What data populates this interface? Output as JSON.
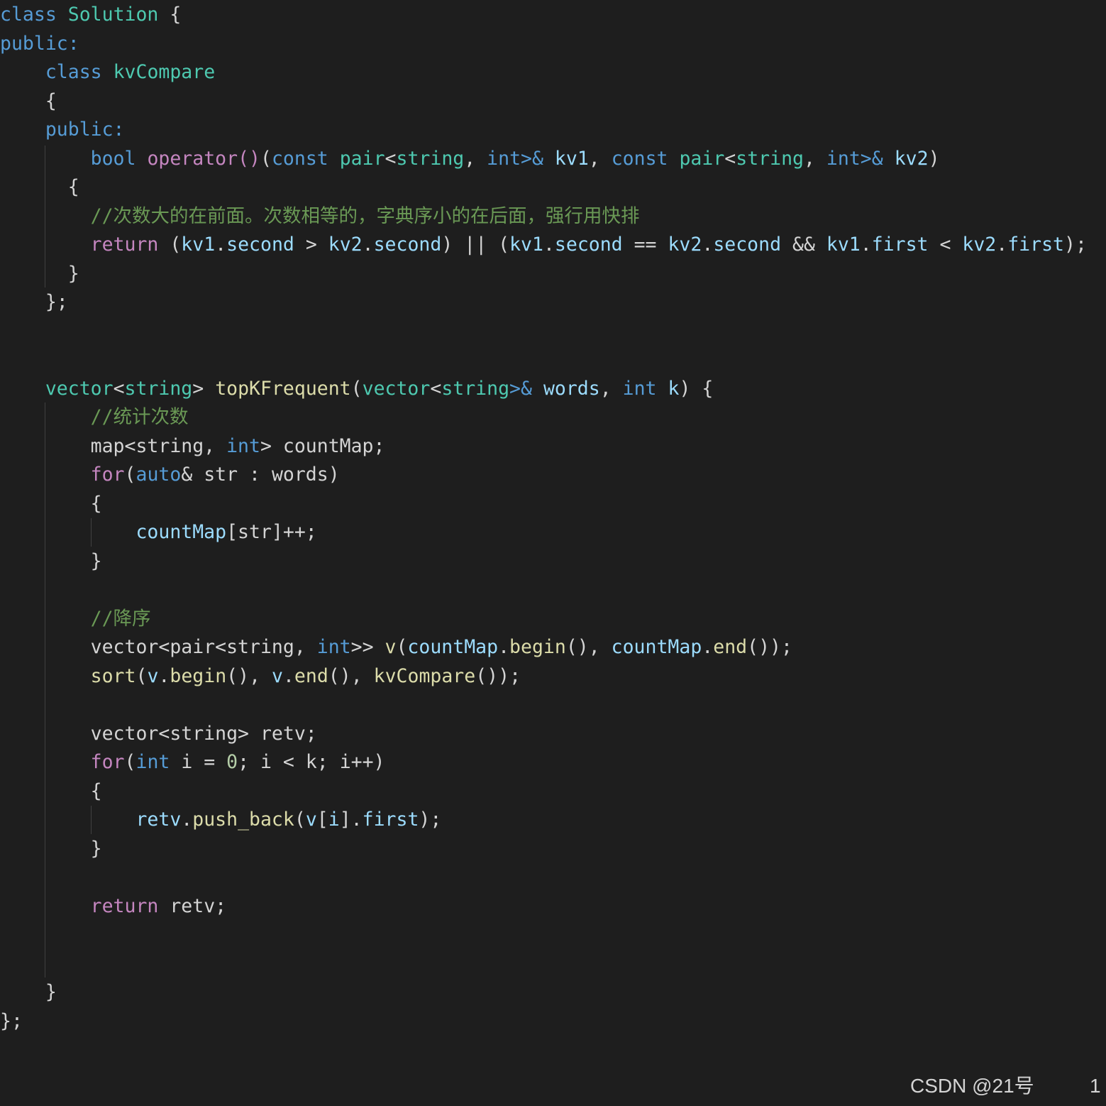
{
  "editor": {
    "lines": [
      [
        {
          "t": "class",
          "c": "kw"
        },
        {
          "t": " ",
          "c": "op"
        },
        {
          "t": "Solution",
          "c": "type"
        },
        {
          "t": " {",
          "c": "op"
        }
      ],
      [
        {
          "t": "public:",
          "c": "kw"
        }
      ],
      [
        {
          "t": "    ",
          "c": "op"
        },
        {
          "t": "class",
          "c": "kw"
        },
        {
          "t": " ",
          "c": "op"
        },
        {
          "t": "kvCompare",
          "c": "type"
        }
      ],
      [
        {
          "t": "    {",
          "c": "op"
        }
      ],
      [
        {
          "t": "    ",
          "c": "op"
        },
        {
          "t": "public:",
          "c": "kw"
        }
      ],
      [
        {
          "t": "        ",
          "c": "op"
        },
        {
          "t": "bool",
          "c": "kw"
        },
        {
          "t": " ",
          "c": "op"
        },
        {
          "t": "operator()",
          "c": "ctrl"
        },
        {
          "t": "(",
          "c": "op"
        },
        {
          "t": "const",
          "c": "kw"
        },
        {
          "t": " ",
          "c": "op"
        },
        {
          "t": "pair",
          "c": "type"
        },
        {
          "t": "<",
          "c": "op"
        },
        {
          "t": "string",
          "c": "type"
        },
        {
          "t": ", ",
          "c": "op"
        },
        {
          "t": "int",
          "c": "kw"
        },
        {
          "t": ">&",
          "c": "kw"
        },
        {
          "t": " ",
          "c": "op"
        },
        {
          "t": "kv1",
          "c": "var"
        },
        {
          "t": ", ",
          "c": "op"
        },
        {
          "t": "const",
          "c": "kw"
        },
        {
          "t": " ",
          "c": "op"
        },
        {
          "t": "pair",
          "c": "type"
        },
        {
          "t": "<",
          "c": "op"
        },
        {
          "t": "string",
          "c": "type"
        },
        {
          "t": ", ",
          "c": "op"
        },
        {
          "t": "int",
          "c": "kw"
        },
        {
          "t": ">&",
          "c": "kw"
        },
        {
          "t": " ",
          "c": "op"
        },
        {
          "t": "kv2",
          "c": "var"
        },
        {
          "t": ")",
          "c": "op"
        }
      ],
      [
        {
          "t": "      {",
          "c": "op"
        }
      ],
      [
        {
          "t": "        ",
          "c": "op"
        },
        {
          "t": "//次数大的在前面。次数相等的，字典序小的在后面，强行用快排",
          "c": "comment"
        }
      ],
      [
        {
          "t": "        ",
          "c": "op"
        },
        {
          "t": "return",
          "c": "ctrl"
        },
        {
          "t": " (",
          "c": "op"
        },
        {
          "t": "kv1",
          "c": "var"
        },
        {
          "t": ".",
          "c": "op"
        },
        {
          "t": "second",
          "c": "var"
        },
        {
          "t": " > ",
          "c": "op"
        },
        {
          "t": "kv2",
          "c": "var"
        },
        {
          "t": ".",
          "c": "op"
        },
        {
          "t": "second",
          "c": "var"
        },
        {
          "t": ") || (",
          "c": "op"
        },
        {
          "t": "kv1",
          "c": "var"
        },
        {
          "t": ".",
          "c": "op"
        },
        {
          "t": "second",
          "c": "var"
        },
        {
          "t": " == ",
          "c": "op"
        },
        {
          "t": "kv2",
          "c": "var"
        },
        {
          "t": ".",
          "c": "op"
        },
        {
          "t": "second",
          "c": "var"
        },
        {
          "t": " && ",
          "c": "op"
        },
        {
          "t": "kv1",
          "c": "var"
        },
        {
          "t": ".",
          "c": "op"
        },
        {
          "t": "first",
          "c": "var"
        },
        {
          "t": " < ",
          "c": "op"
        },
        {
          "t": "kv2",
          "c": "var"
        },
        {
          "t": ".",
          "c": "op"
        },
        {
          "t": "first",
          "c": "var"
        },
        {
          "t": ");",
          "c": "op"
        }
      ],
      [
        {
          "t": "      }",
          "c": "op"
        }
      ],
      [
        {
          "t": "    };",
          "c": "op"
        }
      ],
      [],
      [],
      [
        {
          "t": "    ",
          "c": "op"
        },
        {
          "t": "vector",
          "c": "type"
        },
        {
          "t": "<",
          "c": "op"
        },
        {
          "t": "string",
          "c": "type"
        },
        {
          "t": "> ",
          "c": "op"
        },
        {
          "t": "topKFrequent",
          "c": "fn"
        },
        {
          "t": "(",
          "c": "op"
        },
        {
          "t": "vector",
          "c": "type"
        },
        {
          "t": "<",
          "c": "op"
        },
        {
          "t": "string",
          "c": "type"
        },
        {
          "t": ">&",
          "c": "kw"
        },
        {
          "t": " ",
          "c": "op"
        },
        {
          "t": "words",
          "c": "var"
        },
        {
          "t": ", ",
          "c": "op"
        },
        {
          "t": "int",
          "c": "kw"
        },
        {
          "t": " ",
          "c": "op"
        },
        {
          "t": "k",
          "c": "var"
        },
        {
          "t": ") {",
          "c": "op"
        }
      ],
      [
        {
          "t": "        ",
          "c": "op"
        },
        {
          "t": "//统计次数",
          "c": "comment"
        }
      ],
      [
        {
          "t": "        ",
          "c": "op"
        },
        {
          "t": "map<string, ",
          "c": "op"
        },
        {
          "t": "int",
          "c": "kw"
        },
        {
          "t": "> countMap;",
          "c": "op"
        }
      ],
      [
        {
          "t": "        ",
          "c": "op"
        },
        {
          "t": "for",
          "c": "ctrl"
        },
        {
          "t": "(",
          "c": "op"
        },
        {
          "t": "auto",
          "c": "kw"
        },
        {
          "t": "& str : words)",
          "c": "op"
        }
      ],
      [
        {
          "t": "        {",
          "c": "op"
        }
      ],
      [
        {
          "t": "            ",
          "c": "op"
        },
        {
          "t": "countMap",
          "c": "var"
        },
        {
          "t": "[str]++;",
          "c": "op"
        }
      ],
      [
        {
          "t": "        }",
          "c": "op"
        }
      ],
      [],
      [
        {
          "t": "        ",
          "c": "op"
        },
        {
          "t": "//降序",
          "c": "comment"
        }
      ],
      [
        {
          "t": "        ",
          "c": "op"
        },
        {
          "t": "vector<pair<string, ",
          "c": "op"
        },
        {
          "t": "int",
          "c": "kw"
        },
        {
          "t": ">> ",
          "c": "op"
        },
        {
          "t": "v",
          "c": "fn"
        },
        {
          "t": "(",
          "c": "op"
        },
        {
          "t": "countMap",
          "c": "var"
        },
        {
          "t": ".",
          "c": "op"
        },
        {
          "t": "begin",
          "c": "fn"
        },
        {
          "t": "(), ",
          "c": "op"
        },
        {
          "t": "countMap",
          "c": "var"
        },
        {
          "t": ".",
          "c": "op"
        },
        {
          "t": "end",
          "c": "fn"
        },
        {
          "t": "());",
          "c": "op"
        }
      ],
      [
        {
          "t": "        ",
          "c": "op"
        },
        {
          "t": "sort",
          "c": "fn"
        },
        {
          "t": "(",
          "c": "op"
        },
        {
          "t": "v",
          "c": "var"
        },
        {
          "t": ".",
          "c": "op"
        },
        {
          "t": "begin",
          "c": "fn"
        },
        {
          "t": "(), ",
          "c": "op"
        },
        {
          "t": "v",
          "c": "var"
        },
        {
          "t": ".",
          "c": "op"
        },
        {
          "t": "end",
          "c": "fn"
        },
        {
          "t": "(), ",
          "c": "op"
        },
        {
          "t": "kvCompare",
          "c": "fn"
        },
        {
          "t": "());",
          "c": "op"
        }
      ],
      [],
      [
        {
          "t": "        ",
          "c": "op"
        },
        {
          "t": "vector<string> retv;",
          "c": "op"
        }
      ],
      [
        {
          "t": "        ",
          "c": "op"
        },
        {
          "t": "for",
          "c": "ctrl"
        },
        {
          "t": "(",
          "c": "op"
        },
        {
          "t": "int",
          "c": "kw"
        },
        {
          "t": " i = ",
          "c": "op"
        },
        {
          "t": "0",
          "c": "num"
        },
        {
          "t": "; i < k; i++)",
          "c": "op"
        }
      ],
      [
        {
          "t": "        {",
          "c": "op"
        }
      ],
      [
        {
          "t": "            ",
          "c": "op"
        },
        {
          "t": "retv",
          "c": "var"
        },
        {
          "t": ".",
          "c": "op"
        },
        {
          "t": "push_back",
          "c": "fn"
        },
        {
          "t": "(",
          "c": "op"
        },
        {
          "t": "v",
          "c": "var"
        },
        {
          "t": "[",
          "c": "op"
        },
        {
          "t": "i",
          "c": "var"
        },
        {
          "t": "].",
          "c": "op"
        },
        {
          "t": "first",
          "c": "var"
        },
        {
          "t": ");",
          "c": "op"
        }
      ],
      [
        {
          "t": "        }",
          "c": "op"
        }
      ],
      [],
      [
        {
          "t": "        ",
          "c": "op"
        },
        {
          "t": "return",
          "c": "ctrl"
        },
        {
          "t": " retv;",
          "c": "op"
        }
      ],
      [],
      [],
      [
        {
          "t": "    }",
          "c": "op"
        }
      ],
      [
        {
          "t": "};",
          "c": "op"
        }
      ]
    ]
  },
  "footer": {
    "watermark": "CSDN @21号",
    "line_number": "1"
  },
  "colors": {
    "background": "#1e1e1e",
    "keyword": "#569cd6",
    "type": "#4ec9b0",
    "control": "#c586c0",
    "function": "#dcdcaa",
    "variable": "#9cdcfe",
    "comment": "#6a9955",
    "number": "#b5cea8",
    "text": "#d4d4d4"
  }
}
